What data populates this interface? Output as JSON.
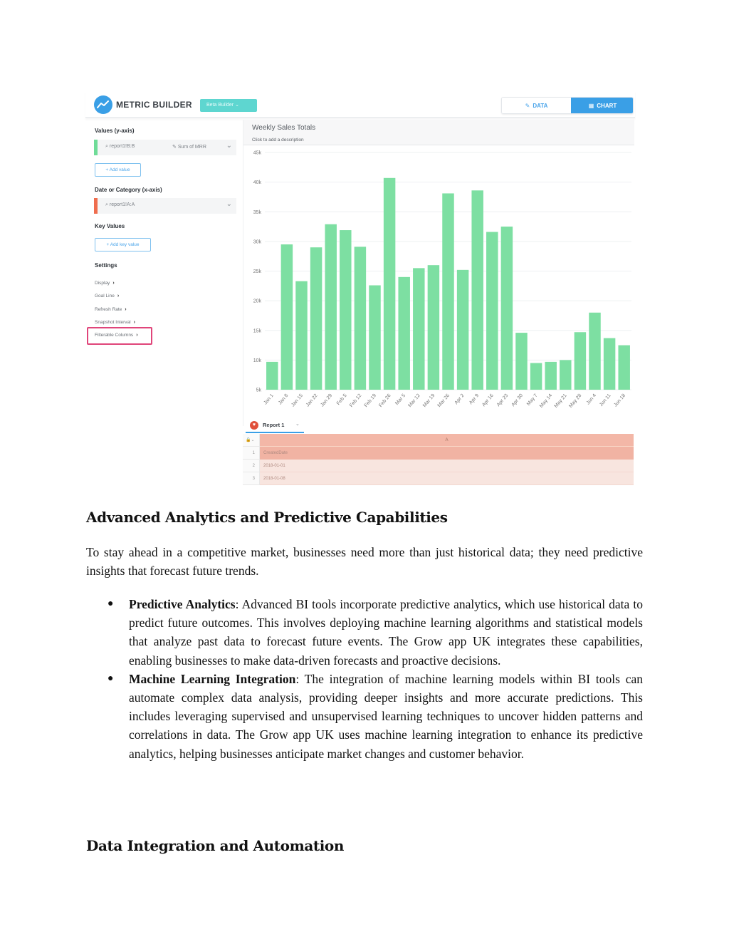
{
  "app": {
    "brand": "METRIC BUILDER",
    "beta_label": "Beta Builder",
    "toggle": {
      "data_label": "DATA",
      "chart_label": "CHART",
      "active": "CHART"
    },
    "colors": {
      "accent": "#3a9fe6",
      "bar": "#7ddfa2",
      "highlight": "#e0457a",
      "value_bar": "#6fdc98",
      "category_bar": "#ef6d4e",
      "table_header": "#f3b7a7"
    }
  },
  "sidebar": {
    "values_title": "Values (y-axis)",
    "value_field": {
      "source": "report1!B:B",
      "aggregation": "Sum of MRR"
    },
    "add_value_label": "+ Add value",
    "category_title": "Date or Category (x-axis)",
    "category_field": {
      "source": "report1!A:A"
    },
    "key_values_title": "Key Values",
    "add_key_value_label": "+ Add key value",
    "settings_title": "Settings",
    "settings_items": [
      {
        "label": "Display"
      },
      {
        "label": "Goal Line"
      },
      {
        "label": "Refresh Rate"
      },
      {
        "label": "Snapshot Interval"
      },
      {
        "label": "Filterable Columns",
        "highlighted": true
      }
    ]
  },
  "chart_header": {
    "title": "Weekly Sales Totals",
    "description": "Click to add a description"
  },
  "chart_data": {
    "type": "bar",
    "title": "Weekly Sales Totals",
    "xlabel": "",
    "ylabel": "",
    "ylim": [
      5000,
      45000
    ],
    "yticks": [
      5000,
      10000,
      15000,
      20000,
      25000,
      30000,
      35000,
      40000,
      45000
    ],
    "ytick_labels": [
      "5k",
      "10k",
      "15k",
      "20k",
      "25k",
      "30k",
      "35k",
      "40k",
      "45k"
    ],
    "grid": true,
    "legend": "none",
    "categories": [
      "Jan 1",
      "Jan 8",
      "Jan 15",
      "Jan 22",
      "Jan 29",
      "Feb 5",
      "Feb 12",
      "Feb 19",
      "Feb 26",
      "Mar 5",
      "Mar 12",
      "Mar 19",
      "Mar 26",
      "Apr 2",
      "Apr 9",
      "Apr 16",
      "Apr 23",
      "Apr 30",
      "May 7",
      "May 14",
      "May 21",
      "May 28",
      "Jun 4",
      "Jun 11",
      "Jun 18"
    ],
    "series": [
      {
        "name": "Sum of MRR",
        "values": [
          9700,
          29500,
          23300,
          29000,
          32900,
          31900,
          29100,
          22600,
          40700,
          24000,
          25500,
          26000,
          38100,
          25200,
          38600,
          31600,
          32500,
          14600,
          9500,
          9700,
          10000,
          14700,
          18000,
          13700,
          12500
        ]
      }
    ]
  },
  "report": {
    "tab_label": "Report 1",
    "column_header": "A",
    "rows": [
      {
        "index": "1",
        "value": "CreatedDate"
      },
      {
        "index": "2",
        "value": "2018-01-01"
      },
      {
        "index": "3",
        "value": "2018-01-08"
      }
    ]
  },
  "document": {
    "heading1": "Advanced Analytics and Predictive Capabilities",
    "intro": "To stay ahead in a competitive market, businesses need more than just historical data; they need predictive insights that forecast future trends.",
    "bullets": [
      {
        "term": "Predictive Analytics",
        "text": ": Advanced BI tools incorporate predictive analytics, which use historical data to predict future outcomes. This involves deploying machine learning algorithms and statistical models that analyze past data to forecast future events. The Grow app UK integrates these capabilities, enabling businesses to make data-driven forecasts and proactive decisions."
      },
      {
        "term": "Machine Learning Integration",
        "text": ": The integration of machine learning models within BI tools can automate complex data analysis, providing deeper insights and more accurate predictions. This includes leveraging supervised and unsupervised learning techniques to uncover hidden patterns and correlations in data. The Grow app UK uses machine learning integration to enhance its predictive analytics, helping businesses anticipate market changes and customer behavior."
      }
    ],
    "heading2": "Data Integration and Automation"
  }
}
